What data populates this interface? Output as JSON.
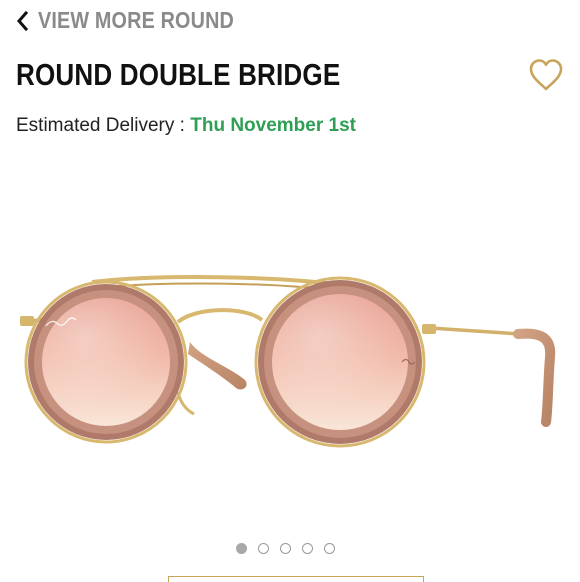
{
  "nav": {
    "back_label": "VIEW MORE ROUND"
  },
  "product": {
    "title": "ROUND DOUBLE BRIDGE",
    "delivery_prefix": "Estimated Delivery : ",
    "delivery_date": "Thu November 1st",
    "image_semantic": "sunglasses-icon"
  },
  "carousel": {
    "total_slides": 5,
    "active_slide": 1
  },
  "colors": {
    "accent_gold": "#c8a45a",
    "delivery_green": "#2e9f55",
    "back_gray": "#8a8a8a"
  }
}
